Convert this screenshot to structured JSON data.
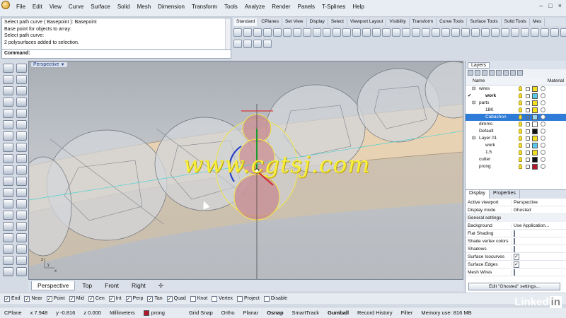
{
  "menubar": {
    "items": [
      "File",
      "Edit",
      "View",
      "Curve",
      "Surface",
      "Solid",
      "Mesh",
      "Dimension",
      "Transform",
      "Tools",
      "Analyze",
      "Render",
      "Panels",
      "T-Splines",
      "Help"
    ],
    "window_controls": [
      "–",
      "□",
      "×"
    ]
  },
  "command_history": [
    "Select path curve ( Basepoint ): Basepoint",
    "Base point for objects to array:",
    "Select path curve:",
    "2 polysurfaces added to selection."
  ],
  "command_prompt": {
    "label": "Command:",
    "value": ""
  },
  "toolbar_tabs": [
    "Standard",
    "CPlanes",
    "Set View",
    "Display",
    "Select",
    "Viewport Layout",
    "Visibility",
    "Transform",
    "Curve Tools",
    "Surface Tools",
    "Solid Tools",
    "Mes"
  ],
  "viewport": {
    "title": "Perspective",
    "watermark": "www.cgtsj.com",
    "tabs": [
      "Perspective",
      "Top",
      "Front",
      "Right"
    ],
    "tab_add": "✢"
  },
  "layers_panel": {
    "tab": "Layers",
    "col_name": "Name",
    "col_material": "Material",
    "rows": [
      {
        "name": "wires",
        "indent": 1,
        "expand": "⊟",
        "color": "#f3df1d",
        "selected": false,
        "current": false
      },
      {
        "name": "work",
        "indent": 2,
        "expand": "",
        "color": "#58c9e8",
        "selected": false,
        "current": true
      },
      {
        "name": "parts",
        "indent": 1,
        "expand": "⊟",
        "color": "#f3df1d",
        "selected": false,
        "current": false
      },
      {
        "name": "18K",
        "indent": 2,
        "expand": "",
        "color": "#f3df1d",
        "selected": false,
        "current": false
      },
      {
        "name": "Cabachon",
        "indent": 2,
        "expand": "",
        "color": "#9ad4ee",
        "selected": true,
        "current": false
      },
      {
        "name": "dimms",
        "indent": 1,
        "expand": "",
        "color": "#ffffff",
        "selected": false,
        "current": false
      },
      {
        "name": "Default",
        "indent": 1,
        "expand": "",
        "color": "#111111",
        "selected": false,
        "current": false
      },
      {
        "name": "Layer 01",
        "indent": 1,
        "expand": "⊟",
        "color": "#f3df1d",
        "selected": false,
        "current": false
      },
      {
        "name": "work",
        "indent": 2,
        "expand": "",
        "color": "#58c9e8",
        "selected": false,
        "current": false
      },
      {
        "name": "1.5",
        "indent": 2,
        "expand": "",
        "color": "#f3df1d",
        "selected": false,
        "current": false
      },
      {
        "name": "cutter",
        "indent": 1,
        "expand": "",
        "color": "#111111",
        "selected": false,
        "current": false
      },
      {
        "name": "prong",
        "indent": 1,
        "expand": "",
        "color": "#b2182b",
        "selected": false,
        "current": false
      }
    ]
  },
  "display_panel": {
    "tabs": [
      "Display",
      "Properties"
    ],
    "active_viewport_label": "Active viewport",
    "active_viewport_value": "Perspective",
    "display_mode_label": "Display mode",
    "display_mode_value": "Ghosted",
    "general_settings": "General settings",
    "background_label": "Background",
    "background_value": "Use Application...",
    "checks": [
      {
        "label": "Flat Shading",
        "checked": false
      },
      {
        "label": "Shade vertex colors",
        "checked": false
      },
      {
        "label": "Shadows",
        "checked": false
      },
      {
        "label": "Surface Isocurves",
        "checked": true
      },
      {
        "label": "Surface Edges",
        "checked": true
      },
      {
        "label": "Mesh Wires",
        "checked": false
      }
    ],
    "edit_button": "Edit \"Ghosted\" settings..."
  },
  "osnaps": [
    {
      "label": "End",
      "checked": true
    },
    {
      "label": "Near",
      "checked": true
    },
    {
      "label": "Point",
      "checked": true
    },
    {
      "label": "Mid",
      "checked": true
    },
    {
      "label": "Cen",
      "checked": true
    },
    {
      "label": "Int",
      "checked": true
    },
    {
      "label": "Perp",
      "checked": true
    },
    {
      "label": "Tan",
      "checked": true
    },
    {
      "label": "Quad",
      "checked": true
    },
    {
      "label": "Knot",
      "checked": false
    },
    {
      "label": "Vertex",
      "checked": false
    },
    {
      "label": "Project",
      "checked": false
    },
    {
      "label": "Disable",
      "checked": false
    }
  ],
  "status": {
    "cplane": "CPlane",
    "x": "x 7.948",
    "y": "y -0.816",
    "z": "z 0.000",
    "units": "Millimeters",
    "layer": "prong",
    "layer_color": "#b2182b",
    "grid_snap": "Grid Snap",
    "ortho": "Ortho",
    "planar": "Planar",
    "osnap": "Osnap",
    "smarttrack": "SmartTrack",
    "gumball": "Gumball",
    "record_history": "Record History",
    "filter": "Filter",
    "memory": "Memory use: 816 MB"
  },
  "brand": {
    "text": "Linked",
    "in": "in"
  }
}
